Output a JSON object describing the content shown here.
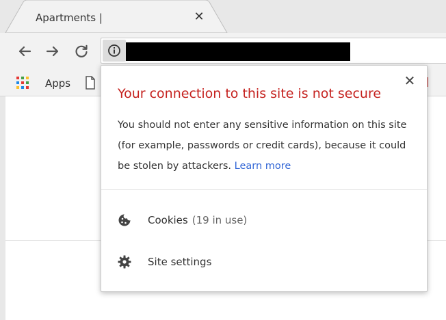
{
  "tab": {
    "title": "Apartments |",
    "close_glyph": "✕"
  },
  "toolbar": {
    "back_icon": "arrow-left-icon",
    "forward_icon": "arrow-right-icon",
    "reload_icon": "reload-icon",
    "site_info_icon": "info-icon"
  },
  "bookmarks": {
    "apps_label": "Apps"
  },
  "popup": {
    "title": "Your connection to this site is not secure",
    "body": "You should not enter any sensitive information on this site (for example, passwords or credit cards), because it could be stolen by attackers. ",
    "learn_more": "Learn more",
    "close_glyph": "✕",
    "cookies_label": "Cookies",
    "cookies_count": "(19 in use)",
    "site_settings_label": "Site settings"
  },
  "colors": {
    "warning_red": "#c5221f",
    "link_blue": "#3367d6",
    "chrome_bg": "#f2f2f2"
  }
}
